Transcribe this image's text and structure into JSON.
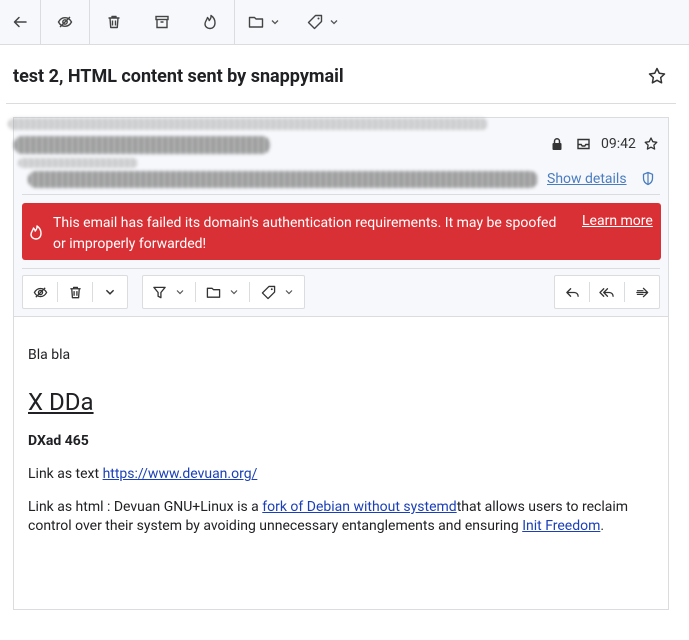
{
  "subject": "test 2, HTML content sent by snappymail",
  "toolbar": {
    "icons": [
      "back-arrow-icon",
      "eye-slash-icon",
      "trash-icon",
      "archive-icon",
      "flame-icon",
      "folder-icon",
      "chevron-down-icon",
      "tag-icon",
      "chevron-down-icon"
    ]
  },
  "header": {
    "time": "09:42",
    "show_details": "Show details"
  },
  "alert": {
    "text": "This email has failed its domain's authentication requirements. It may be spoofed or improperly forwarded!",
    "link": "Learn more"
  },
  "message": {
    "p1": "Bla bla",
    "heading": "X DDa",
    "bold": "DXad 465",
    "link_text_prefix": "Link as text ",
    "link_text_url": "https://www.devuan.org/",
    "html_prefix": "Link as html : Devuan GNU+Linux is a ",
    "html_link1": "fork of Debian without systemd",
    "html_mid": "that allows users to reclaim control over their system by avoiding unnecessary entanglements and ensuring ",
    "html_link2": "Init Freedom",
    "html_end": "."
  },
  "colors": {
    "alert_bg": "#d93035",
    "link": "#1a3fb8",
    "show_details": "#4a7cc1",
    "toolbar_bg": "#f6f8fb"
  }
}
